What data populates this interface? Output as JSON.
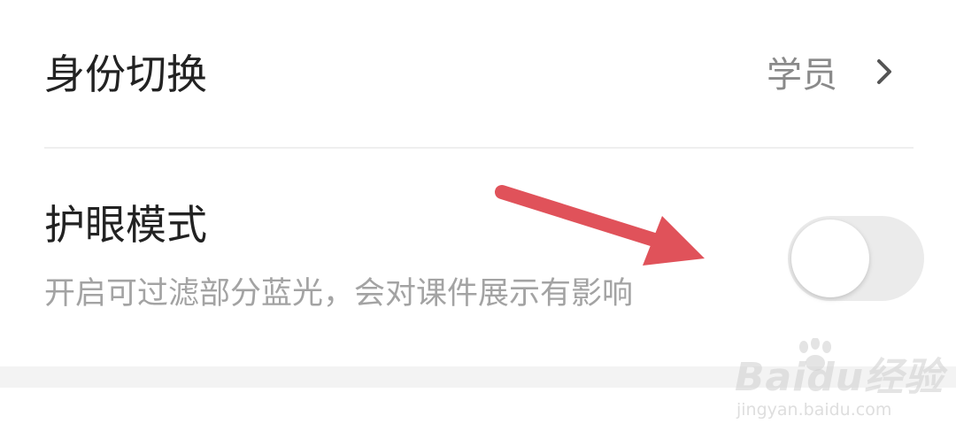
{
  "identity_row": {
    "title": "身份切换",
    "value": "学员"
  },
  "eye_mode_row": {
    "title": "护眼模式",
    "description": "开启可过滤部分蓝光，会对课件展示有影响",
    "enabled": false
  },
  "watermark": {
    "brand": "Baidu经验",
    "url": "jingyan.baidu.com"
  },
  "colors": {
    "annotation_arrow": "#e0525a",
    "primary_text": "#222222",
    "secondary_text": "#a3a3a3",
    "value_text": "#8a8a8a",
    "toggle_off_track": "#ebebeb"
  }
}
